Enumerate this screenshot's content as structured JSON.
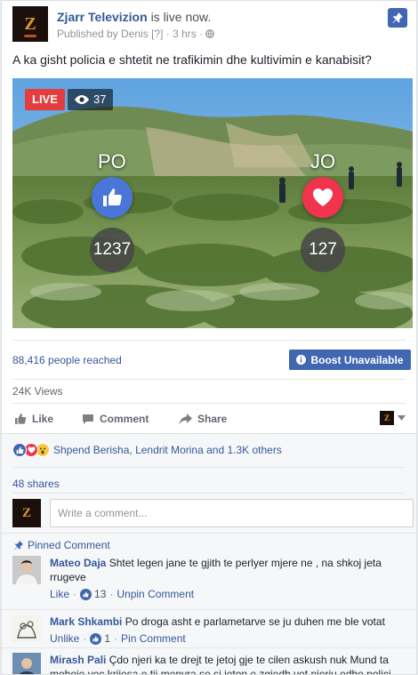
{
  "header": {
    "page_name": "Zjarr Televizion",
    "status_text": "is live now.",
    "published_by": "Published by Denis",
    "published_suffix": "[?] · 3 hrs ·",
    "avatar_letter": "Z"
  },
  "post": {
    "text": "A ka gisht policia e shtetit ne trafikimin dhe kultivimin e kanabisit?"
  },
  "video": {
    "live_label": "LIVE",
    "viewer_count": "37",
    "vote_left": {
      "label": "PO",
      "count": "1237",
      "color": "#4a76d9"
    },
    "vote_right": {
      "label": "JO",
      "count": "127",
      "color": "#f0344e"
    }
  },
  "stats": {
    "reached": "88,416 people reached",
    "boost_label": "Boost Unavailable",
    "views": "24K Views"
  },
  "actions": {
    "like": "Like",
    "comment": "Comment",
    "share": "Share"
  },
  "reactions": {
    "text": "Shpend Berisha, Lendrit Morina and 1.3K others",
    "icons": [
      "like-icon",
      "love-icon",
      "wow-icon"
    ]
  },
  "shares": "48 shares",
  "composer": {
    "placeholder": "Write a comment..."
  },
  "pinned_label": "Pinned Comment",
  "comments": [
    {
      "author": "Mateo Daja",
      "text": "Shtet legen jane te gjith te perlyer mjere ne , na shkoj jeta rrugeve",
      "action": "Like",
      "likes": "13",
      "secondary": "Unpin Comment"
    },
    {
      "author": "Mark Shkambi",
      "text": "Po droga asht e parlametarve se ju duhen me ble votat",
      "action": "Unlike",
      "likes": "1",
      "secondary": "Pin Comment"
    },
    {
      "author": "Mirash Pali",
      "text": "Çdo njeri ka te drejt te jetoj gje te cilen askush nuk Mund ta mohoje vec kriiesa e tii menyra se si jeton e zgjedh vet njeriu edhe polici"
    }
  ],
  "colors": {
    "brand_blue": "#4267b2",
    "link_blue": "#365899",
    "live_red": "#e43d3d"
  }
}
